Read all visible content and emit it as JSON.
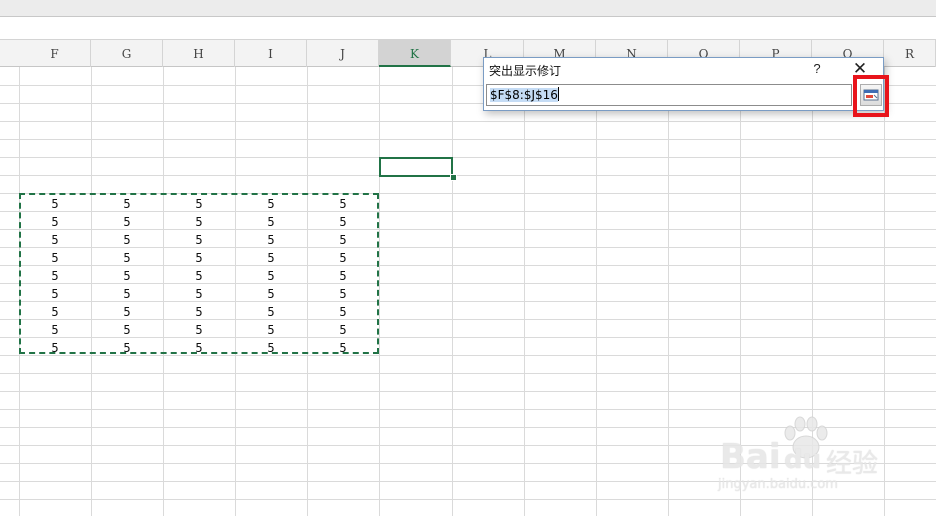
{
  "columns": [
    {
      "label": "F",
      "selected": false
    },
    {
      "label": "G",
      "selected": false
    },
    {
      "label": "H",
      "selected": false
    },
    {
      "label": "I",
      "selected": false
    },
    {
      "label": "J",
      "selected": false
    },
    {
      "label": "K",
      "selected": true
    },
    {
      "label": "L",
      "selected": false
    },
    {
      "label": "M",
      "selected": false
    },
    {
      "label": "N",
      "selected": false
    },
    {
      "label": "O",
      "selected": false
    },
    {
      "label": "P",
      "selected": false
    },
    {
      "label": "Q",
      "selected": false
    },
    {
      "label": "R",
      "selected": false
    }
  ],
  "sheet": {
    "rows": [
      [
        "5",
        "5",
        "5",
        "5",
        "5"
      ],
      [
        "5",
        "5",
        "5",
        "5",
        "5"
      ],
      [
        "5",
        "5",
        "5",
        "5",
        "5"
      ],
      [
        "5",
        "5",
        "5",
        "5",
        "5"
      ],
      [
        "5",
        "5",
        "5",
        "5",
        "5"
      ],
      [
        "5",
        "5",
        "5",
        "5",
        "5"
      ],
      [
        "5",
        "5",
        "5",
        "5",
        "5"
      ],
      [
        "5",
        "5",
        "5",
        "5",
        "5"
      ],
      [
        "5",
        "5",
        "5",
        "5",
        "5"
      ]
    ]
  },
  "dialog": {
    "title": "突出显示修订",
    "help_label": "?",
    "close_label": "✕",
    "range_value": "$F$8:$J$16"
  },
  "icons": {
    "collapse": "range-collapse-icon",
    "help": "help-icon",
    "close": "close-icon"
  },
  "colors": {
    "accent": "#217346",
    "highlight": "#e8141b"
  },
  "watermark": {
    "brand": "Bai",
    "brand_tail": "du",
    "cn": "经验",
    "url": "jingyan.baidu.com"
  }
}
